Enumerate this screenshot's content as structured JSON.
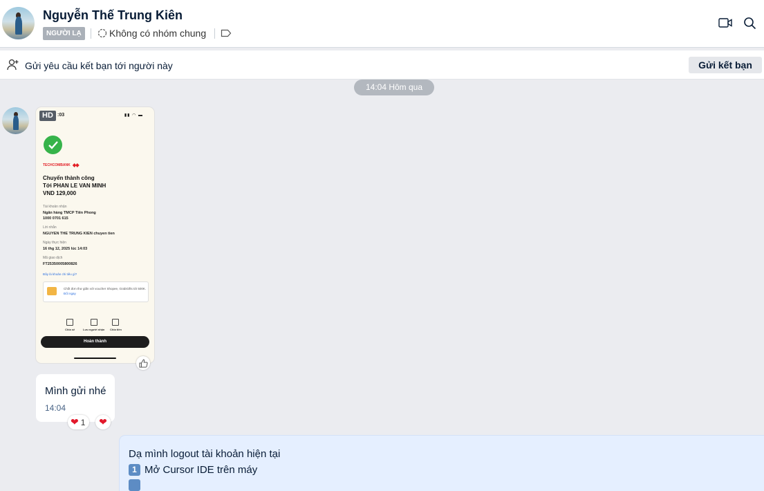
{
  "header": {
    "name": "Nguyễn Thế Trung Kiên",
    "badge": "NGƯỜI LẠ",
    "group_status": "Không có nhóm chung",
    "icons": [
      "video-call-icon",
      "search-icon",
      "tag-icon",
      "group-icon"
    ]
  },
  "friend_request": {
    "text": "Gửi yêu cầu kết bạn tới người này",
    "button": "Gửi kết bạn"
  },
  "time_divider": "14:04 Hôm qua",
  "image_message": {
    "hd_badge": "HD",
    "receipt": {
      "time": ":03",
      "bank": "TECHCOMBANK",
      "title": "Chuyển thành công",
      "recipient": "Tới PHAN LE VAN MINH",
      "amount": "VND 129,000",
      "account_label": "Tài khoản nhận",
      "account_bank": "Ngân hàng TMCP Tiên Phong",
      "account_number": "1000 0701 615",
      "message_label": "Lời nhắn",
      "message_value": "NGUYEN THE TRUNG KIEN chuyen tien",
      "date_label": "Ngày thực hiện",
      "date_value": "16 thg 12, 2025 lúc 14:03",
      "txn_label": "Mã giao dịch",
      "txn_value": "FT25350005800826",
      "details_link": "Đây là khoản chi tiêu gì?",
      "promo": "Chốt đơn thư giãn với voucher Shopee, GrabGifts tới 500K.",
      "promo_link": "Đổi ngay",
      "actions": [
        "Chia sẻ",
        "Lưu người nhận",
        "Chia tiền"
      ],
      "done": "Hoàn thành"
    }
  },
  "text_message": {
    "body": "Mình gửi nhé",
    "time": "14:04",
    "reaction_count": "1",
    "reaction": "❤"
  },
  "outgoing_message": {
    "line1": "Dạ mình logout tài khoản hiện tại",
    "line2_num": "1",
    "line2": "Mở Cursor IDE trên máy"
  }
}
